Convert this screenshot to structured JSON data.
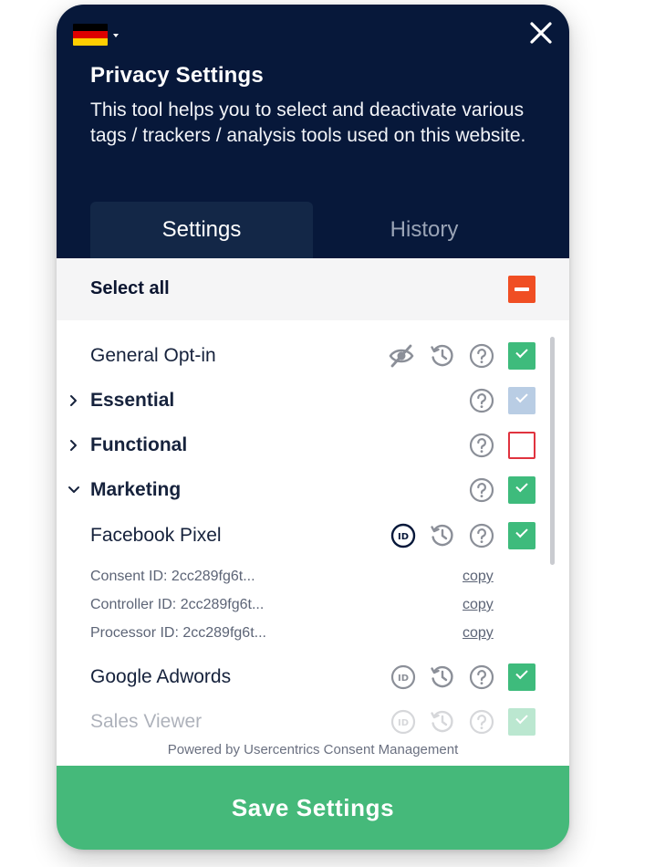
{
  "header": {
    "title": "Privacy Settings",
    "description": "This tool helps you to select and deactivate various tags / trackers / analysis tools used on this website.",
    "language_flag": "german-flag",
    "colors": {
      "background": "#07183a",
      "active_tab": "#132747"
    }
  },
  "tabs": [
    {
      "label": "Settings",
      "active": true
    },
    {
      "label": "History",
      "active": false
    }
  ],
  "select_all": {
    "label": "Select all",
    "state": "indeterminate",
    "color": "#f04e23"
  },
  "rows": {
    "general_optin": {
      "label": "General Opt-in",
      "icons": [
        "eye-off-icon",
        "history-icon",
        "help-icon"
      ],
      "checked": true
    },
    "essential": {
      "label": "Essential",
      "expanded": false,
      "checked": true,
      "locked": true
    },
    "functional": {
      "label": "Functional",
      "expanded": false,
      "checked": false
    },
    "marketing": {
      "label": "Marketing",
      "expanded": true,
      "checked": true
    },
    "facebook_pixel": {
      "label": "Facebook Pixel",
      "icons": [
        "id-icon",
        "history-icon",
        "help-icon"
      ],
      "checked": true
    },
    "google_adwords": {
      "label": "Google Adwords",
      "icons": [
        "id-icon",
        "history-icon",
        "help-icon"
      ],
      "checked": true
    },
    "sales_viewer": {
      "label": "Sales Viewer",
      "icons": [
        "id-icon",
        "history-icon",
        "help-icon"
      ],
      "checked": true
    }
  },
  "details": [
    {
      "label": "Consent ID: 2cc289fg6t...",
      "link": "copy"
    },
    {
      "label": "Controller ID: 2cc289fg6t...",
      "link": "copy"
    },
    {
      "label": "Processor ID: 2cc289fg6t...",
      "link": "copy"
    }
  ],
  "footer": {
    "powered_by": "Powered by Usercentrics Consent Management",
    "save_label": "Save Settings",
    "save_color": "#45b97a"
  },
  "checkbox_colors": {
    "checked": "#3ebb7c",
    "locked": "#b9cde4",
    "unchecked_border": "#e0333f"
  }
}
